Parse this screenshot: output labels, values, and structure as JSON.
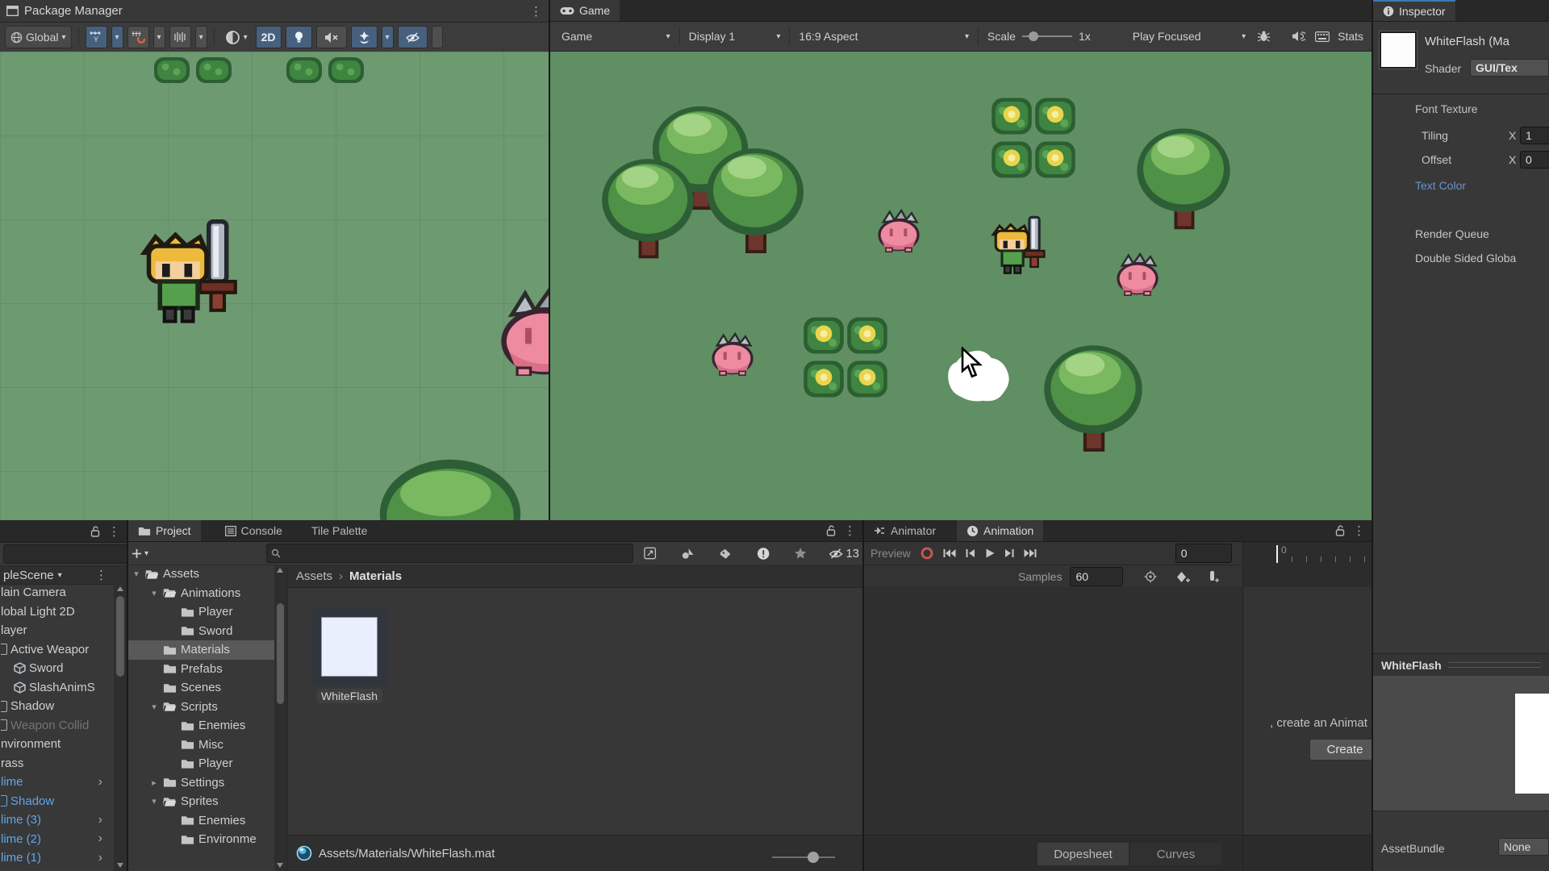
{
  "colors": {
    "toggle_on_blue": "#46607e",
    "link_blue": "#6b93cf",
    "prefab_blue": "#62a4e8",
    "scene_green": "#6d9a70",
    "game_green": "#5f8f63",
    "slime_pink": "#ee8ba0",
    "inspector_accent": "#3e79b8"
  },
  "scene_panel": {
    "title": "Package Manager",
    "toolbar": {
      "global_label": "Global",
      "mode_2d": "2D"
    }
  },
  "game_panel": {
    "tab": "Game",
    "toolbar": {
      "display_target": "Game",
      "display": "Display 1",
      "aspect": "16:9 Aspect",
      "scale_label": "Scale",
      "scale_value": "1x",
      "play_mode": "Play Focused",
      "stats_label": "Stats"
    }
  },
  "inspector": {
    "tab": "Inspector",
    "material_title": "WhiteFlash (Ma",
    "shader_label": "Shader",
    "shader_value": "GUI/Tex",
    "font_texture": "Font Texture",
    "tiling_label": "Tiling",
    "tiling_axis": "X",
    "tiling_x": "1",
    "offset_label": "Offset",
    "offset_axis": "X",
    "offset_x": "0",
    "text_color": "Text Color",
    "render_queue": "Render Queue",
    "double_sided": "Double Sided Globa",
    "preview_title": "WhiteFlash",
    "assetbundle_label": "AssetBundle",
    "assetbundle_value": "None"
  },
  "hierarchy": {
    "scene_header": "pleScene",
    "items": [
      {
        "label": "lain Camera"
      },
      {
        "label": "lobal Light 2D"
      },
      {
        "label": "layer"
      },
      {
        "label": "Active Weapor",
        "icon": "fragment"
      },
      {
        "label": "Sword",
        "icon": "cube"
      },
      {
        "label": "SlashAnimS",
        "icon": "cube"
      },
      {
        "label": "Shadow",
        "icon": "fragment"
      },
      {
        "label": "Weapon Collid",
        "icon": "fragment",
        "style": "disabled"
      },
      {
        "label": "nvironment"
      },
      {
        "label": "rass"
      },
      {
        "label": "lime",
        "style": "prefab",
        "expand": true
      },
      {
        "label": "Shadow",
        "icon": "fragment",
        "style": "prefab"
      },
      {
        "label": "lime (3)",
        "style": "prefab",
        "expand": true
      },
      {
        "label": "lime (2)",
        "style": "prefab",
        "expand": true
      },
      {
        "label": "lime (1)",
        "style": "prefab",
        "expand": true
      }
    ]
  },
  "project": {
    "tabs": [
      {
        "label": "Project",
        "icon": "folder-icon",
        "active": true
      },
      {
        "label": "Console",
        "icon": "console-icon"
      },
      {
        "label": "Tile Palette"
      }
    ],
    "breadcrumb": {
      "root": "Assets",
      "separator": "›",
      "current": "Materials"
    },
    "folders": [
      {
        "label": "Assets",
        "depth": 0,
        "caret": "open",
        "open": true
      },
      {
        "label": "Animations",
        "depth": 1,
        "caret": "open",
        "open": true
      },
      {
        "label": "Player",
        "depth": 2
      },
      {
        "label": "Sword",
        "depth": 2
      },
      {
        "label": "Materials",
        "depth": 1,
        "selected": true
      },
      {
        "label": "Prefabs",
        "depth": 1
      },
      {
        "label": "Scenes",
        "depth": 1
      },
      {
        "label": "Scripts",
        "depth": 1,
        "caret": "open",
        "open": true
      },
      {
        "label": "Enemies",
        "depth": 2
      },
      {
        "label": "Misc",
        "depth": 2
      },
      {
        "label": "Player",
        "depth": 2
      },
      {
        "label": "Settings",
        "depth": 1,
        "caret": "closed"
      },
      {
        "label": "Sprites",
        "depth": 1,
        "caret": "open",
        "open": true
      },
      {
        "label": "Enemies",
        "depth": 2
      },
      {
        "label": "Environme",
        "depth": 2
      }
    ],
    "asset_name": "WhiteFlash",
    "footer_path": "Assets/Materials/WhiteFlash.mat",
    "eye_count": "13"
  },
  "animation": {
    "tab_animator": "Animator",
    "tab_animation": "Animation",
    "preview_label": "Preview",
    "frame_value": "0",
    "samples_label": "Samples",
    "samples_value": "60",
    "ruler_zero": "0",
    "message": ", create an Animat",
    "create_button": "Create",
    "bottom_tab_dopesheet": "Dopesheet",
    "bottom_tab_curves": "Curves"
  }
}
